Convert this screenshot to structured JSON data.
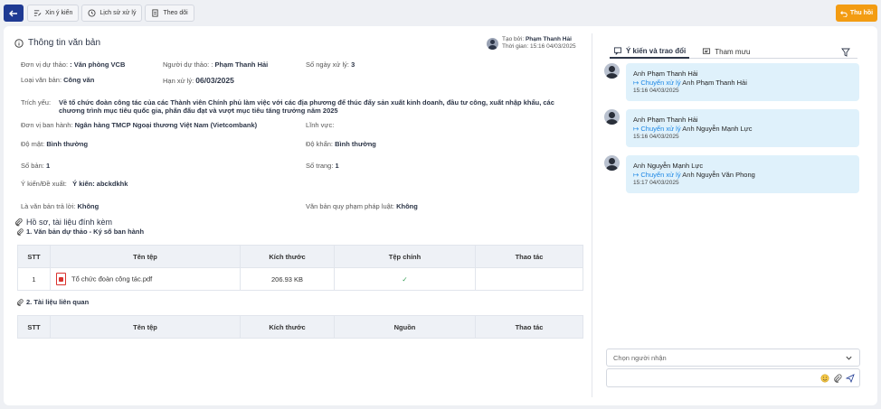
{
  "toolbar": {
    "buttons": [
      "Xin ý kiến",
      "Lịch sử xử lý",
      "Theo dõi"
    ],
    "recall": "Thu hồi"
  },
  "info": {
    "title": "Thông tin văn bản",
    "creator_label": "Tạo bởi:",
    "creator_name": "Phạm Thanh Hải",
    "time_label": "Thời gian:",
    "time_value": "15:16 04/03/2025",
    "unit_label": "Đơn vị dự thảo:",
    "unit_value": ": Văn phòng VCB",
    "drafter_label": "Người dự thảo: :",
    "drafter_value": "Phạm Thanh Hải",
    "days_label": "Số ngày xử lý:",
    "days_value": "3",
    "type_label": "Loại văn bản:",
    "type_value": "Công văn",
    "deadline_label": "Hạn xử lý:",
    "deadline_value": "06/03/2025",
    "summary_label": "Trích yếu:",
    "summary_value": "Về tổ chức đoàn công tác của các Thành viên Chính phủ làm việc với các địa phương để thúc đẩy sản xuất kinh doanh, đầu tư công, xuất nhập khẩu, các chương trình mục tiêu quốc gia, phấn đấu đạt và vượt mục tiêu tăng trưởng năm 2025",
    "issuer_label": "Đơn vị ban hành:",
    "issuer_value": "Ngân hàng TMCP Ngoại thương Việt Nam (Vietcombank)",
    "field_label": "Lĩnh vực:",
    "field_value": "",
    "secret_label": "Độ mật:",
    "secret_value": "Bình thường",
    "urgency_label": "Độ khẩn:",
    "urgency_value": "Bình thường",
    "copies_label": "Số bản:",
    "copies_value": "1",
    "pages_label": "Số trang:",
    "pages_value": "1",
    "opinion_label": "Ý kiến/Đề xuất:",
    "opinion_value": "Ý kiến: abckdkhk",
    "reply_label": "Là văn bản trả lời:",
    "reply_value": "Không",
    "legal_label": "Văn bản quy phạm pháp luật:",
    "legal_value": "Không"
  },
  "attachments": {
    "title": "Hồ sơ, tài liệu đính kèm",
    "draft_title": "1. Văn bản dự thảo - Ký số ban hành",
    "related_title": "2. Tài liệu liên quan",
    "draft_headers": [
      "STT",
      "Tên tệp",
      "Kích thước",
      "Tệp chính",
      "Thao tác"
    ],
    "draft_rows": [
      {
        "stt": "1",
        "name": "Tổ chức đoàn công tác.pdf",
        "size": "206.93 KB",
        "main": "✓",
        "action": ""
      }
    ],
    "related_headers": [
      "STT",
      "Tên tệp",
      "Kích thước",
      "Nguồn",
      "Thao tác"
    ]
  },
  "panel": {
    "tab_active": "Ý kiến và trao đổi",
    "tab_other": "Tham mưu",
    "comments": [
      {
        "prefix": "Anh",
        "from": "Phạm Thanh Hải",
        "action": "Chuyển xử lý",
        "to_prefix": "Anh",
        "to": "Phạm Thanh Hải",
        "time": "15:16 04/03/2025"
      },
      {
        "prefix": "Anh",
        "from": "Phạm Thanh Hải",
        "action": "Chuyển xử lý",
        "to_prefix": "Anh",
        "to": "Nguyễn Mạnh Lực",
        "time": "15:16 04/03/2025"
      },
      {
        "prefix": "Anh",
        "from": "Nguyễn Mạnh Lực",
        "action": "Chuyển xử lý",
        "to_prefix": "Anh",
        "to": "Nguyễn Văn Phong",
        "time": "15:17 04/03/2025"
      }
    ],
    "recipient_placeholder": "Chọn người nhận"
  },
  "colors": {
    "primary": "#1f3a93",
    "accent": "#f39c12",
    "bubble": "#dff1fb",
    "link": "#1e88e5"
  }
}
